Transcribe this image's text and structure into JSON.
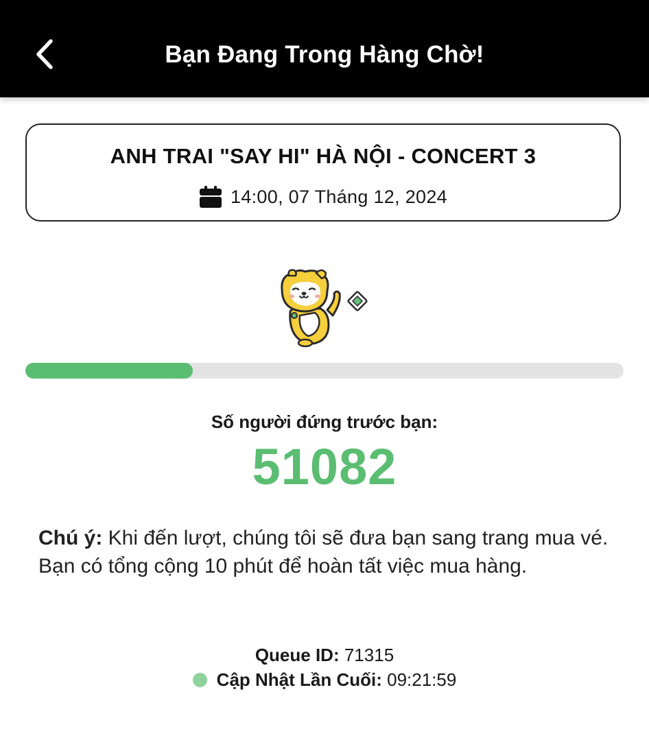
{
  "header": {
    "title": "Bạn Đang Trong Hàng Chờ!",
    "back_icon": "chevron-left-icon"
  },
  "event": {
    "name": "ANH TRAI \"SAY HI\" HÀ NỘI - CONCERT 3",
    "date": "14:00, 07 Tháng 12, 2024",
    "date_icon": "calendar-icon"
  },
  "mascot": {
    "icon": "shiba-dog-mascot-icon"
  },
  "progress": {
    "fraction": 0.28
  },
  "queue": {
    "ahead_label": "Số người đứng trước bạn:",
    "ahead_count": "51082"
  },
  "notice": {
    "label": "Chú ý:",
    "text": " Khi đến lượt, chúng tôi sẽ đưa bạn sang trang mua vé. Bạn có tổng cộng 10 phút để hoàn tất việc mua hàng."
  },
  "meta": {
    "queue_id_label": "Queue ID:",
    "queue_id_value": " 71315",
    "last_update_label": "Cập Nhật Lần Cuối:",
    "last_update_value": " 09:21:59"
  },
  "colors": {
    "header_bg": "#000000",
    "accent_green": "#5bbd72",
    "track_gray": "#e3e3e3",
    "status_dot": "#8fd29b"
  }
}
